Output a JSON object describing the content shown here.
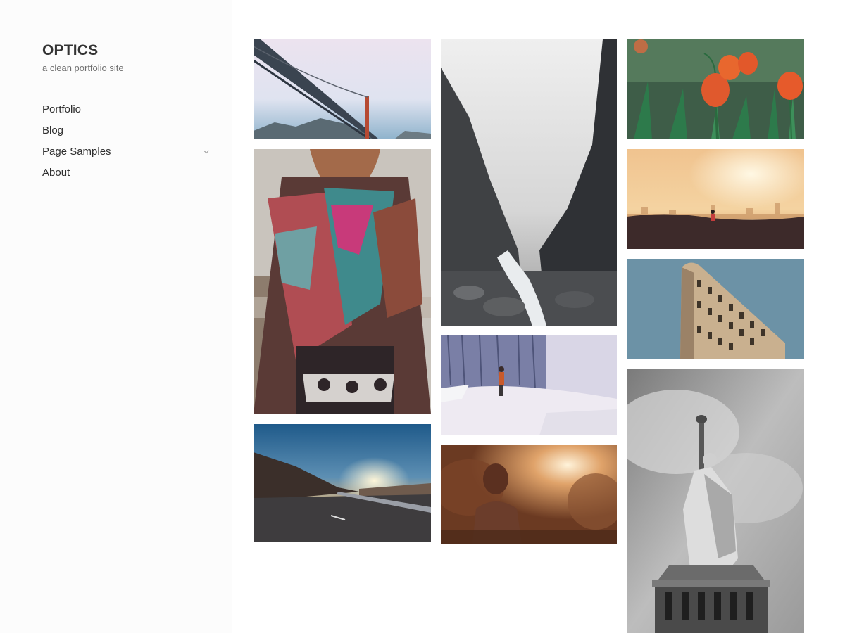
{
  "site": {
    "title": "OPTICS",
    "description": "a clean portfolio site"
  },
  "nav": {
    "items": [
      {
        "label": "Portfolio"
      },
      {
        "label": "Blog"
      },
      {
        "label": "Page Samples",
        "has_submenu": true,
        "icon": "chevron-down-icon"
      },
      {
        "label": "About"
      }
    ]
  },
  "gallery": {
    "items": [
      {
        "subject": "golden gate bridge in fog"
      },
      {
        "subject": "woman in colorful poncho"
      },
      {
        "subject": "mountain road at sunset"
      },
      {
        "subject": "misty canyon with river"
      },
      {
        "subject": "person in snowy forest"
      },
      {
        "subject": "woman in sunset glow"
      },
      {
        "subject": "orange tulips"
      },
      {
        "subject": "city skyline sunrise with runner"
      },
      {
        "subject": "flatiron building"
      },
      {
        "subject": "statue of liberty black and white"
      }
    ]
  },
  "colors": {
    "title": "#333333",
    "nav_text": "#2f2f2f",
    "description": "#6f6f6f",
    "sidebar_bg": "#fcfcfc"
  }
}
